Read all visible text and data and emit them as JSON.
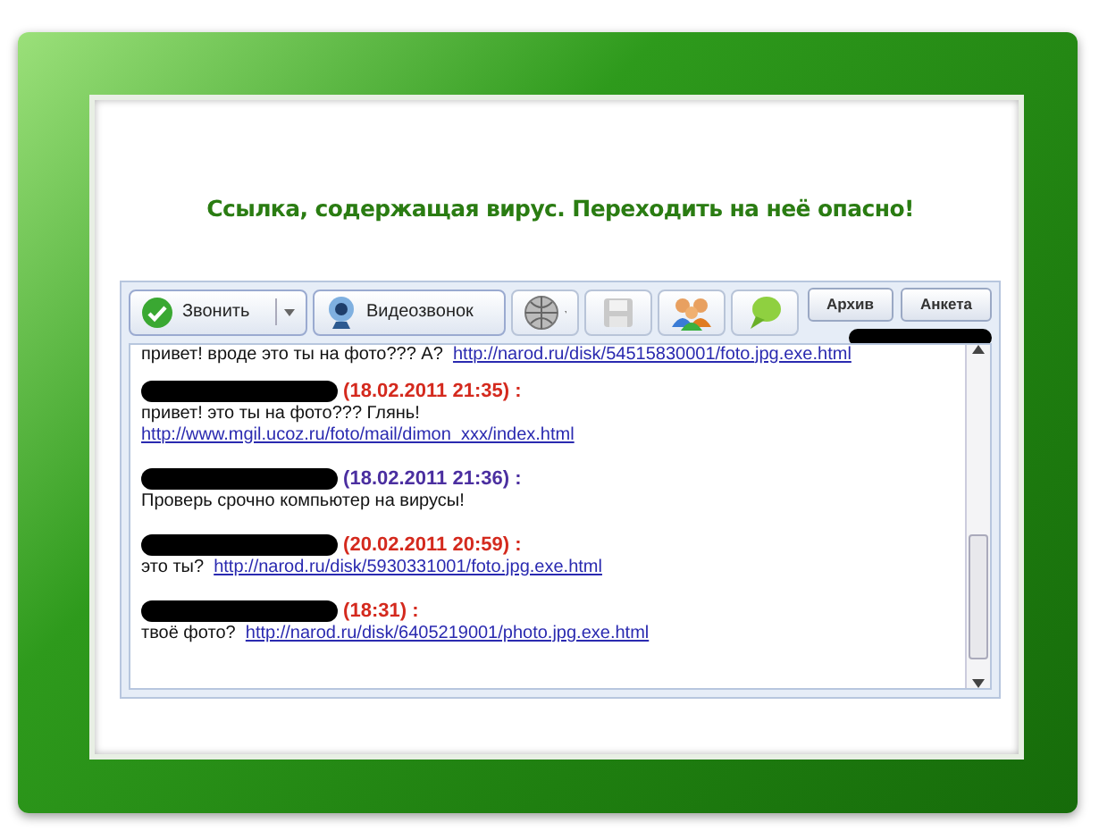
{
  "heading": "Ссылка, содержащая вирус. Переходить на неё опасно!",
  "toolbar": {
    "call_button": "Звонить",
    "video_button": "Видеозвонок",
    "save_disabled": true
  },
  "tabs": [
    {
      "label": "Архив",
      "selected": false
    },
    {
      "label": "Анкета",
      "selected": false
    }
  ],
  "messages": [
    {
      "kind": "continued",
      "text": "привет! вроде это ты на фото??? А?",
      "link": "http://narod.ru/disk/54515830001/foto.jpg.exe.html"
    },
    {
      "kind": "link_below",
      "time": "(18.02.2011 21:35) :",
      "color": "#d42a1e",
      "text": "привет! это ты на фото??? Глянь!",
      "link": "http://www.mgil.ucoz.ru/foto/mail/dimon_xxx/index.html"
    },
    {
      "kind": "inline",
      "time": "(18.02.2011 21:36) :",
      "color": "#4b2fa0",
      "text": "Проверь срочно компьютер на вирусы!"
    },
    {
      "kind": "inline",
      "time": "(20.02.2011 20:59) :",
      "color": "#d42a1e",
      "text": "это ты?",
      "link": "http://narod.ru/disk/5930331001/foto.jpg.exe.html"
    },
    {
      "kind": "inline",
      "time": "(18:31) :",
      "color": "#d42a1e",
      "text": "твоё фото?",
      "link": "http://narod.ru/disk/6405219001/photo.jpg.exe.html"
    }
  ]
}
